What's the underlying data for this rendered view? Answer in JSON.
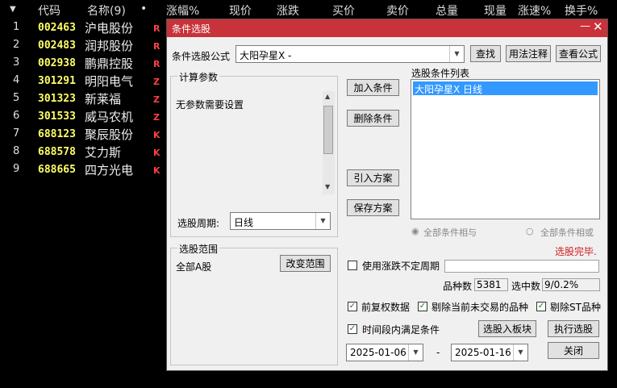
{
  "header": {
    "sort_icon": "▼",
    "columns": [
      "代码",
      "名称(9)",
      "•",
      "涨幅%",
      "现价",
      "涨跌",
      "买价",
      "卖价",
      "总量",
      "现量",
      "涨速%",
      "换手%"
    ]
  },
  "stocks": [
    {
      "num": "1",
      "code": "002463",
      "name": "沪电股份",
      "flag": "R"
    },
    {
      "num": "2",
      "code": "002483",
      "name": "润邦股份",
      "flag": "R"
    },
    {
      "num": "3",
      "code": "002938",
      "name": "鹏鼎控股",
      "flag": "R"
    },
    {
      "num": "4",
      "code": "301291",
      "name": "明阳电气",
      "flag": "Z"
    },
    {
      "num": "5",
      "code": "301323",
      "name": "新莱福",
      "flag": "Z"
    },
    {
      "num": "6",
      "code": "301533",
      "name": "威马农机",
      "flag": "Z"
    },
    {
      "num": "7",
      "code": "688123",
      "name": "聚辰股份",
      "flag": "K"
    },
    {
      "num": "8",
      "code": "688578",
      "name": "艾力斯",
      "flag": "K"
    },
    {
      "num": "9",
      "code": "688665",
      "name": "四方光电",
      "flag": "K"
    }
  ],
  "dialog": {
    "title": "条件选股",
    "minimize": "—",
    "close": "✕",
    "formula_label": "条件选股公式",
    "formula_value": "大阳孕星X    -",
    "find_btn": "查找",
    "usage_btn": "用法注释",
    "view_btn": "查看公式",
    "params_title": "计算参数",
    "params_text": "无参数需要设置",
    "period_label": "选股周期:",
    "period_value": "日线",
    "add_btn": "加入条件",
    "delete_btn": "删除条件",
    "import_btn": "引入方案",
    "save_btn": "保存方案",
    "list_title": "选股条件列表",
    "list_items": [
      "大阳孕星X  日线"
    ],
    "radio_and": "全部条件相与",
    "radio_or": "全部条件相或",
    "status": "选股完毕.",
    "range_title": "选股范围",
    "range_value": "全部A股",
    "change_range_btn": "改变范围",
    "use_period_label": "使用涨跌不定周期",
    "count_label": "品种数",
    "count_value": "5381",
    "selected_label": "选中数",
    "selected_value": "9/0.2%",
    "opt_fq": "前复权数据",
    "opt_untraded": "剔除当前未交易的品种",
    "opt_st": "剔除ST品种",
    "opt_period": "时间段内满足条件",
    "to_block_btn": "选股入板块",
    "exec_btn": "执行选股",
    "close_btn": "关闭",
    "date_from": "2025-01-06",
    "date_sep": "-",
    "date_to": "2025-01-16"
  },
  "colors": {
    "title_bar": "#c8323a",
    "code": "#ffff66",
    "flag": "#ff4040",
    "status": "#d02020",
    "selection": "#3399ff"
  }
}
